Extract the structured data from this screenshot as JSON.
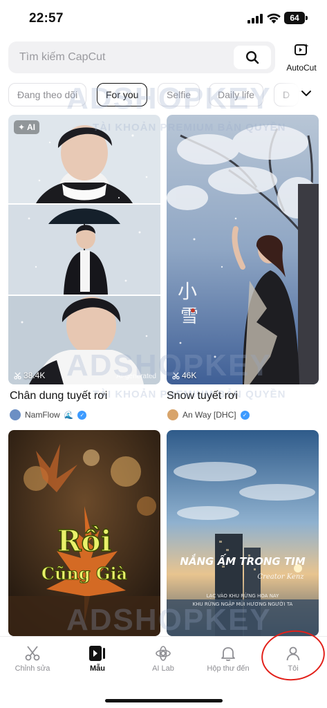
{
  "status": {
    "time": "22:57",
    "battery": "64"
  },
  "search": {
    "placeholder": "Tìm kiếm CapCut"
  },
  "autocut": {
    "label": "AutoCut"
  },
  "tabs": [
    {
      "label": "Đang theo dõi"
    },
    {
      "label": "For you"
    },
    {
      "label": "Selfie"
    },
    {
      "label": "Daily life"
    },
    {
      "label": "D"
    }
  ],
  "templates": [
    {
      "title": "Chân dung tuyết rơi",
      "uses": "38.4K",
      "creator": "NamFlow",
      "ai_badge": "AI",
      "ai_generated": "AI-generated"
    },
    {
      "title": "Snow tuyết rơi",
      "uses": "46K",
      "creator": "An Way [DHC]"
    },
    {
      "overlay_text_1": "Rồi",
      "overlay_text_2": "Cũng Già"
    },
    {
      "overlay_text": "NẮNG ẤM TRONG TIM",
      "overlay_signature": "Creator Kenz",
      "overlay_caption_1": "LẠC VÀO KHU RỪNG HOA NAY",
      "overlay_caption_2": "KHU RỪNG NGẬP MÙI HƯƠNG NGƯỜI TA"
    }
  ],
  "watermark": {
    "brand": "ADSHOPKEY",
    "tagline": "TÀI KHOẢN PREMIUM BẢN QUYỀN"
  },
  "nav": [
    {
      "label": "Chỉnh sửa",
      "icon": "scissors-icon"
    },
    {
      "label": "Mẫu",
      "icon": "template-icon"
    },
    {
      "label": "AI Lab",
      "icon": "ai-lab-icon"
    },
    {
      "label": "Hộp thư đến",
      "icon": "bell-icon"
    },
    {
      "label": "Tôi",
      "icon": "profile-icon"
    }
  ],
  "colors": {
    "accent": "#111111",
    "muted": "#8e8e93",
    "annotation": "#e2201a",
    "verified": "#3d9bff"
  }
}
